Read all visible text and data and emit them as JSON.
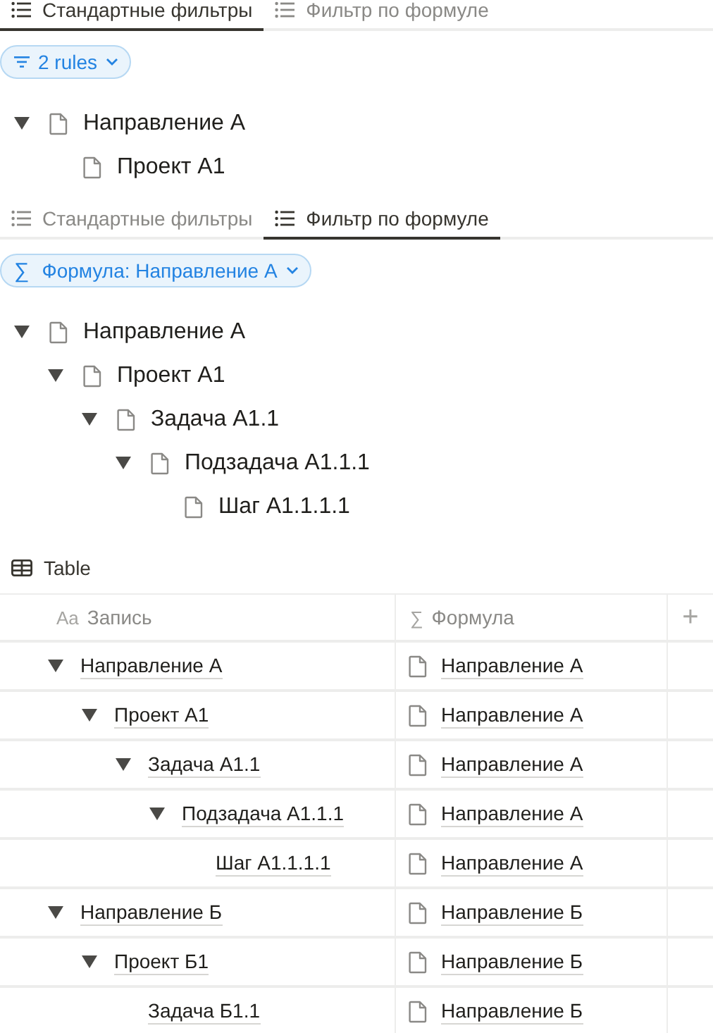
{
  "views": [
    {
      "tabs": [
        {
          "label": "Стандартные фильтры",
          "selected": true
        },
        {
          "label": "Фильтр по формуле",
          "selected": false
        }
      ],
      "filter": {
        "kind": "rules",
        "label": "2 rules"
      },
      "tree": [
        {
          "title": "Направление А",
          "expanded": true,
          "children": [
            {
              "title": "Проект А1"
            }
          ]
        }
      ]
    },
    {
      "tabs": [
        {
          "label": "Стандартные фильтры",
          "selected": false
        },
        {
          "label": "Фильтр по формуле",
          "selected": true
        }
      ],
      "filter": {
        "kind": "formula",
        "icon": "∑",
        "label": "Формула: Направление А"
      },
      "tree": [
        {
          "title": "Направление А",
          "expanded": true,
          "children": [
            {
              "title": "Проект А1",
              "expanded": true,
              "children": [
                {
                  "title": "Задача А1.1",
                  "expanded": true,
                  "children": [
                    {
                      "title": "Подзадача А1.1.1",
                      "expanded": true,
                      "children": [
                        {
                          "title": "Шаг А1.1.1.1"
                        }
                      ]
                    }
                  ]
                }
              ]
            }
          ]
        }
      ]
    }
  ],
  "table": {
    "title": "Table",
    "columns": [
      {
        "kind": "title",
        "icon": "Aa",
        "label": "Запись"
      },
      {
        "kind": "formula",
        "icon": "∑",
        "label": "Формула"
      }
    ],
    "add_column": "+",
    "rows": [
      {
        "title": "Направление А",
        "formula": "Направление А",
        "expanded": true,
        "children": [
          {
            "title": "Проект А1",
            "formula": "Направление А",
            "expanded": true,
            "children": [
              {
                "title": "Задача А1.1",
                "formula": "Направление А",
                "expanded": true,
                "children": [
                  {
                    "title": "Подзадача А1.1.1",
                    "formula": "Направление А",
                    "expanded": true,
                    "children": [
                      {
                        "title": "Шаг А1.1.1.1",
                        "formula": "Направление А"
                      }
                    ]
                  }
                ]
              }
            ]
          }
        ]
      },
      {
        "title": "Направление Б",
        "formula": "Направление Б",
        "expanded": true,
        "children": [
          {
            "title": "Проект Б1",
            "formula": "Направление Б",
            "expanded": true,
            "children": [
              {
                "title": "Задача Б1.1",
                "formula": "Направление Б"
              }
            ]
          }
        ]
      }
    ]
  }
}
